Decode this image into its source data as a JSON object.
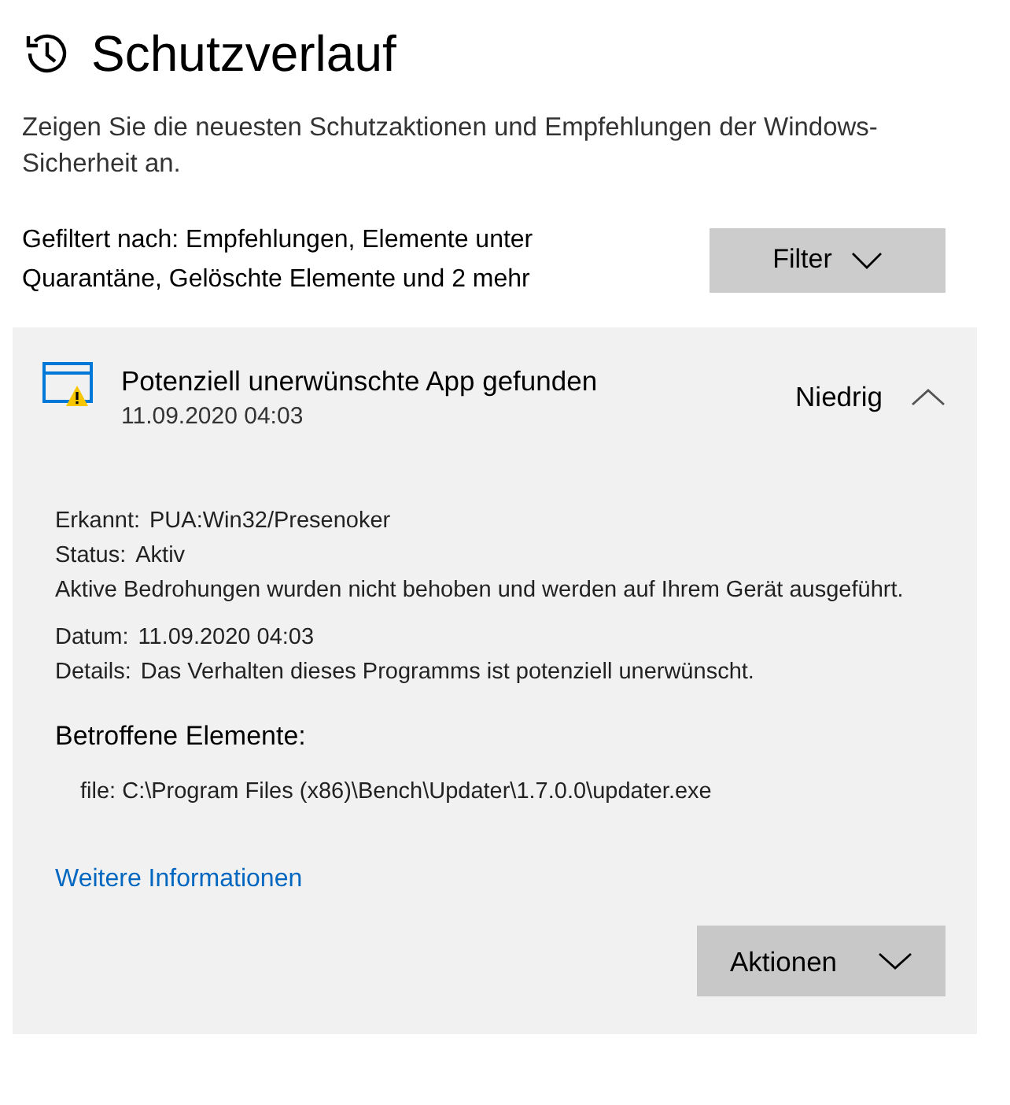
{
  "page": {
    "title": "Schutzverlauf",
    "description": "Zeigen Sie die neuesten Schutzaktionen und Empfehlungen der Windows-Sicherheit an."
  },
  "filter": {
    "summary": "Gefiltert nach: Empfehlungen, Elemente unter Quarantäne, Gelöschte Elemente und 2 mehr",
    "button": "Filter"
  },
  "items": [
    {
      "title": "Potenziell unerwünschte App gefunden",
      "time": "11.09.2020 04:03",
      "severity": "Niedrig",
      "expanded": true,
      "fields": [
        {
          "label": "Erkannt:",
          "value": "PUA:Win32/Presenoker"
        },
        {
          "label": "Status:",
          "value": "Aktiv"
        }
      ],
      "status_note": "Aktive Bedrohungen wurden nicht behoben und werden auf Ihrem Gerät ausgeführt.",
      "fields_2": [
        {
          "label": "Datum:",
          "value": "11.09.2020 04:03"
        },
        {
          "label": "Details:",
          "value": "Das Verhalten dieses Programms ist potenziell unerwünscht."
        }
      ],
      "affected_heading": "Betroffene Elemente:",
      "affected": [
        "file: C:\\Program Files (x86)\\Bench\\Updater\\1.7.0.0\\updater.exe"
      ],
      "link": "Weitere Informationen",
      "actions_button": "Aktionen"
    }
  ]
}
